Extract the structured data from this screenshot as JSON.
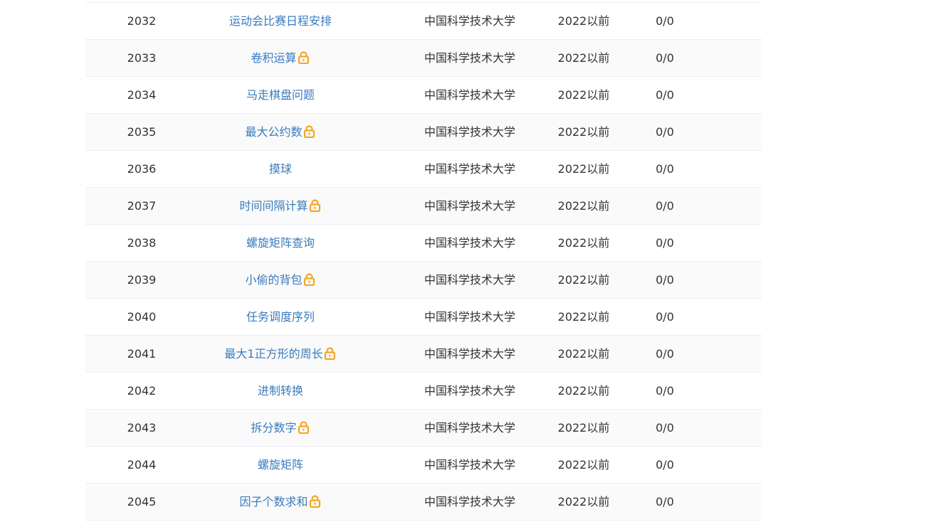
{
  "lock_color": "#f5a623",
  "link_color": "#3a7bbf",
  "rows": [
    {
      "id": "2032",
      "title": "运动会比赛日程安排",
      "locked": false,
      "source": "中国科学技术大学",
      "year": "2022以前",
      "ratio": "0/0"
    },
    {
      "id": "2033",
      "title": "卷积运算",
      "locked": true,
      "source": "中国科学技术大学",
      "year": "2022以前",
      "ratio": "0/0"
    },
    {
      "id": "2034",
      "title": "马走棋盘问题",
      "locked": false,
      "source": "中国科学技术大学",
      "year": "2022以前",
      "ratio": "0/0"
    },
    {
      "id": "2035",
      "title": "最大公约数",
      "locked": true,
      "source": "中国科学技术大学",
      "year": "2022以前",
      "ratio": "0/0"
    },
    {
      "id": "2036",
      "title": "摸球",
      "locked": false,
      "source": "中国科学技术大学",
      "year": "2022以前",
      "ratio": "0/0"
    },
    {
      "id": "2037",
      "title": "时间间隔计算",
      "locked": true,
      "source": "中国科学技术大学",
      "year": "2022以前",
      "ratio": "0/0"
    },
    {
      "id": "2038",
      "title": "螺旋矩阵查询",
      "locked": false,
      "source": "中国科学技术大学",
      "year": "2022以前",
      "ratio": "0/0"
    },
    {
      "id": "2039",
      "title": "小偷的背包",
      "locked": true,
      "source": "中国科学技术大学",
      "year": "2022以前",
      "ratio": "0/0"
    },
    {
      "id": "2040",
      "title": "任务调度序列",
      "locked": false,
      "source": "中国科学技术大学",
      "year": "2022以前",
      "ratio": "0/0"
    },
    {
      "id": "2041",
      "title": "最大1正方形的周长",
      "locked": true,
      "source": "中国科学技术大学",
      "year": "2022以前",
      "ratio": "0/0"
    },
    {
      "id": "2042",
      "title": "进制转换",
      "locked": false,
      "source": "中国科学技术大学",
      "year": "2022以前",
      "ratio": "0/0"
    },
    {
      "id": "2043",
      "title": "拆分数字",
      "locked": true,
      "source": "中国科学技术大学",
      "year": "2022以前",
      "ratio": "0/0"
    },
    {
      "id": "2044",
      "title": "螺旋矩阵",
      "locked": false,
      "source": "中国科学技术大学",
      "year": "2022以前",
      "ratio": "0/0"
    },
    {
      "id": "2045",
      "title": "因子个数求和",
      "locked": true,
      "source": "中国科学技术大学",
      "year": "2022以前",
      "ratio": "0/0"
    }
  ]
}
